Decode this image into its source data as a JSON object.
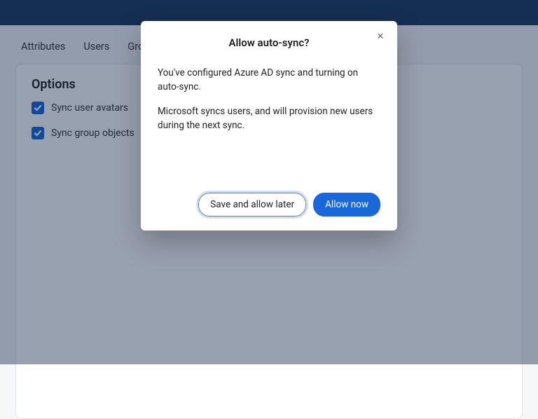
{
  "topbar": {
    "title": ""
  },
  "tabs": {
    "attributes": "Attributes",
    "users": "Users",
    "groups": "Groups"
  },
  "options": {
    "heading": "Options",
    "sync_avatars_label": "Sync user avatars",
    "sync_avatars_checked": true,
    "sync_groups_label": "Sync group objects",
    "sync_groups_checked": true
  },
  "modal": {
    "title": "Allow auto-sync?",
    "line1": "You've configured Azure AD sync and turning on auto-sync.",
    "line2": "Microsoft syncs users, and will provision new users during the next sync.",
    "save_later_label": "Save and allow later",
    "allow_now_label": "Allow now"
  }
}
